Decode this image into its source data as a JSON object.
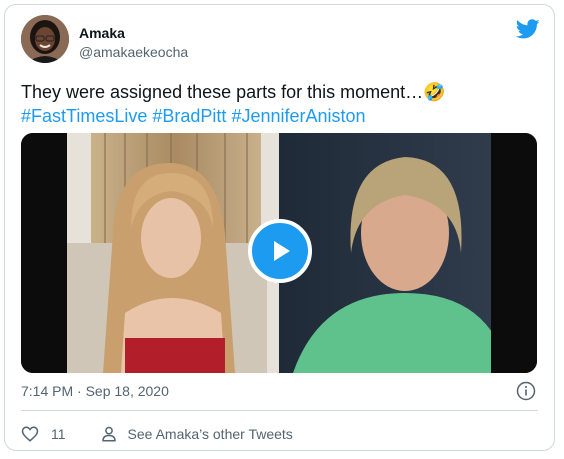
{
  "author": {
    "name": "Amaka",
    "handle": "@amakaekeocha"
  },
  "tweet": {
    "text": "They were assigned these parts for this moment…",
    "emoji": "🤣",
    "hashtags": [
      "#FastTimesLive",
      "#BradPitt",
      "#JenniferAniston"
    ]
  },
  "meta": {
    "timestamp": "7:14 PM · Sep 18, 2020"
  },
  "actions": {
    "like_count": "11",
    "see_other_label": "See Amaka’s other Tweets"
  },
  "icons": {
    "brand": "twitter-bird-icon",
    "play": "play-icon",
    "info": "info-icon",
    "like": "heart-icon",
    "person": "person-icon"
  },
  "colors": {
    "accent": "#1d9bf0",
    "secondary_text": "#536471",
    "border": "#cfd9de"
  }
}
